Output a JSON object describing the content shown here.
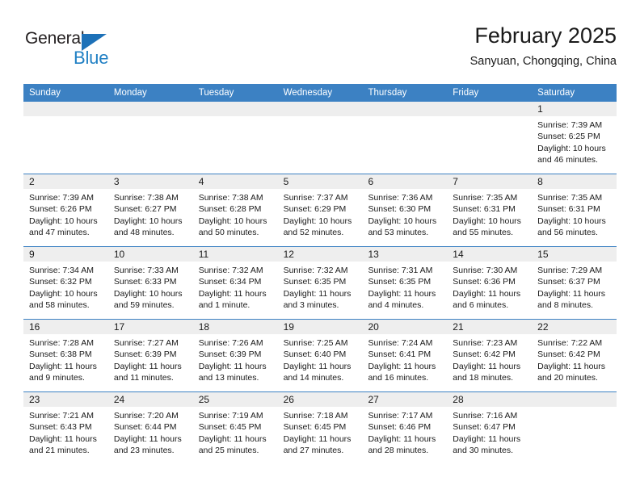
{
  "brand": {
    "name_part1": "General",
    "name_part2": "Blue",
    "triangle_color": "#1d71b8",
    "blue_text_color": "#2080c4"
  },
  "header": {
    "title": "February 2025",
    "subtitle": "Sanyuan, Chongqing, China",
    "header_bg_color": "#3c81c3",
    "daynum_bg_color": "#eeeeee"
  },
  "weekdays": [
    "Sunday",
    "Monday",
    "Tuesday",
    "Wednesday",
    "Thursday",
    "Friday",
    "Saturday"
  ],
  "weeks": [
    [
      {
        "day": "",
        "l1": "",
        "l2": "",
        "l3": "",
        "l4": ""
      },
      {
        "day": "",
        "l1": "",
        "l2": "",
        "l3": "",
        "l4": ""
      },
      {
        "day": "",
        "l1": "",
        "l2": "",
        "l3": "",
        "l4": ""
      },
      {
        "day": "",
        "l1": "",
        "l2": "",
        "l3": "",
        "l4": ""
      },
      {
        "day": "",
        "l1": "",
        "l2": "",
        "l3": "",
        "l4": ""
      },
      {
        "day": "",
        "l1": "",
        "l2": "",
        "l3": "",
        "l4": ""
      },
      {
        "day": "1",
        "l1": "Sunrise: 7:39 AM",
        "l2": "Sunset: 6:25 PM",
        "l3": "Daylight: 10 hours",
        "l4": "and 46 minutes."
      }
    ],
    [
      {
        "day": "2",
        "l1": "Sunrise: 7:39 AM",
        "l2": "Sunset: 6:26 PM",
        "l3": "Daylight: 10 hours",
        "l4": "and 47 minutes."
      },
      {
        "day": "3",
        "l1": "Sunrise: 7:38 AM",
        "l2": "Sunset: 6:27 PM",
        "l3": "Daylight: 10 hours",
        "l4": "and 48 minutes."
      },
      {
        "day": "4",
        "l1": "Sunrise: 7:38 AM",
        "l2": "Sunset: 6:28 PM",
        "l3": "Daylight: 10 hours",
        "l4": "and 50 minutes."
      },
      {
        "day": "5",
        "l1": "Sunrise: 7:37 AM",
        "l2": "Sunset: 6:29 PM",
        "l3": "Daylight: 10 hours",
        "l4": "and 52 minutes."
      },
      {
        "day": "6",
        "l1": "Sunrise: 7:36 AM",
        "l2": "Sunset: 6:30 PM",
        "l3": "Daylight: 10 hours",
        "l4": "and 53 minutes."
      },
      {
        "day": "7",
        "l1": "Sunrise: 7:35 AM",
        "l2": "Sunset: 6:31 PM",
        "l3": "Daylight: 10 hours",
        "l4": "and 55 minutes."
      },
      {
        "day": "8",
        "l1": "Sunrise: 7:35 AM",
        "l2": "Sunset: 6:31 PM",
        "l3": "Daylight: 10 hours",
        "l4": "and 56 minutes."
      }
    ],
    [
      {
        "day": "9",
        "l1": "Sunrise: 7:34 AM",
        "l2": "Sunset: 6:32 PM",
        "l3": "Daylight: 10 hours",
        "l4": "and 58 minutes."
      },
      {
        "day": "10",
        "l1": "Sunrise: 7:33 AM",
        "l2": "Sunset: 6:33 PM",
        "l3": "Daylight: 10 hours",
        "l4": "and 59 minutes."
      },
      {
        "day": "11",
        "l1": "Sunrise: 7:32 AM",
        "l2": "Sunset: 6:34 PM",
        "l3": "Daylight: 11 hours",
        "l4": "and 1 minute."
      },
      {
        "day": "12",
        "l1": "Sunrise: 7:32 AM",
        "l2": "Sunset: 6:35 PM",
        "l3": "Daylight: 11 hours",
        "l4": "and 3 minutes."
      },
      {
        "day": "13",
        "l1": "Sunrise: 7:31 AM",
        "l2": "Sunset: 6:35 PM",
        "l3": "Daylight: 11 hours",
        "l4": "and 4 minutes."
      },
      {
        "day": "14",
        "l1": "Sunrise: 7:30 AM",
        "l2": "Sunset: 6:36 PM",
        "l3": "Daylight: 11 hours",
        "l4": "and 6 minutes."
      },
      {
        "day": "15",
        "l1": "Sunrise: 7:29 AM",
        "l2": "Sunset: 6:37 PM",
        "l3": "Daylight: 11 hours",
        "l4": "and 8 minutes."
      }
    ],
    [
      {
        "day": "16",
        "l1": "Sunrise: 7:28 AM",
        "l2": "Sunset: 6:38 PM",
        "l3": "Daylight: 11 hours",
        "l4": "and 9 minutes."
      },
      {
        "day": "17",
        "l1": "Sunrise: 7:27 AM",
        "l2": "Sunset: 6:39 PM",
        "l3": "Daylight: 11 hours",
        "l4": "and 11 minutes."
      },
      {
        "day": "18",
        "l1": "Sunrise: 7:26 AM",
        "l2": "Sunset: 6:39 PM",
        "l3": "Daylight: 11 hours",
        "l4": "and 13 minutes."
      },
      {
        "day": "19",
        "l1": "Sunrise: 7:25 AM",
        "l2": "Sunset: 6:40 PM",
        "l3": "Daylight: 11 hours",
        "l4": "and 14 minutes."
      },
      {
        "day": "20",
        "l1": "Sunrise: 7:24 AM",
        "l2": "Sunset: 6:41 PM",
        "l3": "Daylight: 11 hours",
        "l4": "and 16 minutes."
      },
      {
        "day": "21",
        "l1": "Sunrise: 7:23 AM",
        "l2": "Sunset: 6:42 PM",
        "l3": "Daylight: 11 hours",
        "l4": "and 18 minutes."
      },
      {
        "day": "22",
        "l1": "Sunrise: 7:22 AM",
        "l2": "Sunset: 6:42 PM",
        "l3": "Daylight: 11 hours",
        "l4": "and 20 minutes."
      }
    ],
    [
      {
        "day": "23",
        "l1": "Sunrise: 7:21 AM",
        "l2": "Sunset: 6:43 PM",
        "l3": "Daylight: 11 hours",
        "l4": "and 21 minutes."
      },
      {
        "day": "24",
        "l1": "Sunrise: 7:20 AM",
        "l2": "Sunset: 6:44 PM",
        "l3": "Daylight: 11 hours",
        "l4": "and 23 minutes."
      },
      {
        "day": "25",
        "l1": "Sunrise: 7:19 AM",
        "l2": "Sunset: 6:45 PM",
        "l3": "Daylight: 11 hours",
        "l4": "and 25 minutes."
      },
      {
        "day": "26",
        "l1": "Sunrise: 7:18 AM",
        "l2": "Sunset: 6:45 PM",
        "l3": "Daylight: 11 hours",
        "l4": "and 27 minutes."
      },
      {
        "day": "27",
        "l1": "Sunrise: 7:17 AM",
        "l2": "Sunset: 6:46 PM",
        "l3": "Daylight: 11 hours",
        "l4": "and 28 minutes."
      },
      {
        "day": "28",
        "l1": "Sunrise: 7:16 AM",
        "l2": "Sunset: 6:47 PM",
        "l3": "Daylight: 11 hours",
        "l4": "and 30 minutes."
      },
      {
        "day": "",
        "l1": "",
        "l2": "",
        "l3": "",
        "l4": ""
      }
    ]
  ]
}
